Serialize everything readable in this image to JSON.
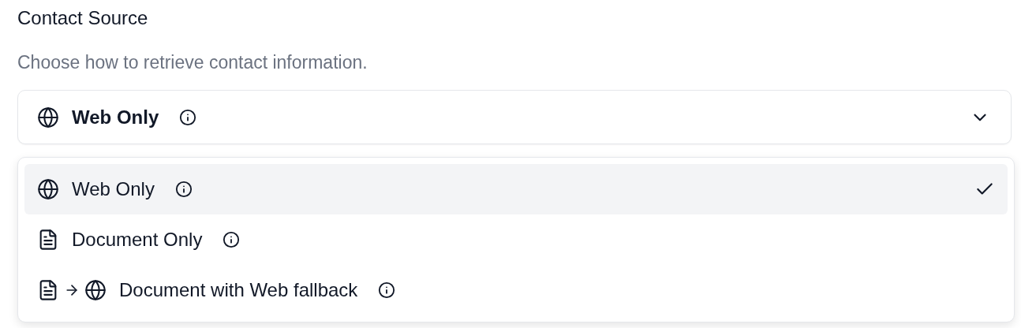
{
  "field": {
    "label": "Contact Source",
    "description": "Choose how to retrieve contact information.",
    "value": {
      "label": "Web Only",
      "kind": "web"
    },
    "expanded": true,
    "options": [
      {
        "label": "Web Only",
        "kind": "web",
        "selected": true
      },
      {
        "label": "Document Only",
        "kind": "document",
        "selected": false
      },
      {
        "label": "Document with Web fallback",
        "kind": "document_then_web",
        "selected": false
      }
    ]
  }
}
